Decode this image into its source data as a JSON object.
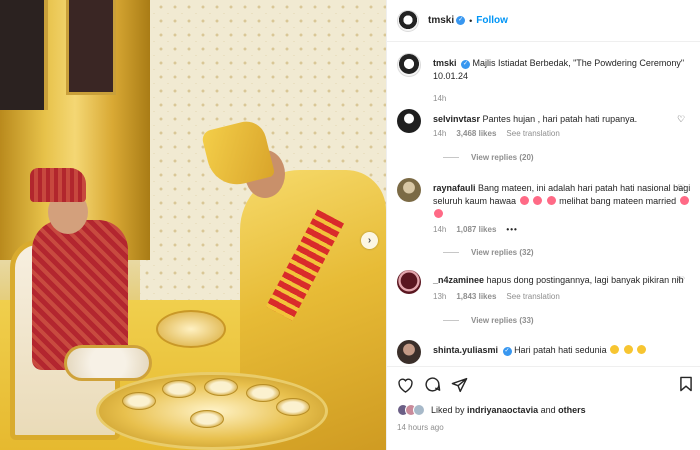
{
  "post": {
    "username": "tmski",
    "follow_label": "Follow",
    "separator": "•",
    "next_arrow": "›"
  },
  "caption": {
    "username": "tmski",
    "text": "Majlis Istiadat Berbedak, \"The Powdering Ceremony\" 10.01.24",
    "time": "14h"
  },
  "comments": [
    {
      "username": "selvinvtasr",
      "text": "Pantes hujan , hari patah hati rupanya.",
      "time": "14h",
      "likes": "3,468 likes",
      "reply_label": "See translation",
      "view_replies": "View replies (20)",
      "avatar_color": "#1f1f1f"
    },
    {
      "username": "raynafauli",
      "text": "Bang mateen, ini adalah hari patah hati nasional bagi seluruh kaum hawaa",
      "text_tail": "melihat bang mateen married",
      "time": "14h",
      "likes": "1,087 likes",
      "more": "•••",
      "view_replies": "View replies (32)",
      "avatar_color": "#7b6a45"
    },
    {
      "username": "_n4zaminee",
      "text": "hapus dong postingannya, lagi banyak pikiran nih",
      "time": "13h",
      "likes": "1,843 likes",
      "reply_label": "See translation",
      "view_replies": "View replies (33)",
      "avatar_color": "#5a1620"
    },
    {
      "username": "shinta.yuliasmi",
      "text": "Hari patah hati sedunia",
      "avatar_color": "#3b2f2a"
    }
  ],
  "footer": {
    "liked_prefix": "Liked by",
    "liked_user": "indriyanaoctavia",
    "liked_and": "and",
    "liked_others": "others",
    "time_ago": "14 hours ago"
  },
  "icons": {
    "verified": "verified-badge-icon",
    "heart": "heart-icon",
    "comment": "comment-icon",
    "share": "share-icon",
    "bookmark": "bookmark-icon"
  },
  "colors": {
    "accent": "#0095f6",
    "verified": "#3897f0",
    "muted": "#8e8e8e"
  }
}
